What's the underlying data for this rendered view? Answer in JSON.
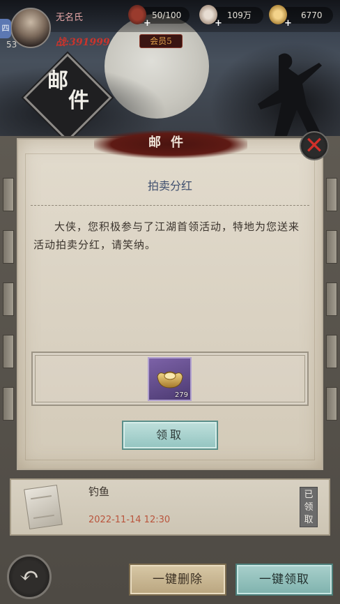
{
  "header": {
    "player_name": "无名氏",
    "level": "53",
    "power": "战:391999",
    "vip": "会员5",
    "left_tab_label": "四",
    "resources": [
      {
        "icon": "stamina-gourd-icon",
        "value": "50/100"
      },
      {
        "icon": "copper-coin-icon",
        "value": "109万"
      },
      {
        "icon": "gold-ingot-icon",
        "value": "6770"
      }
    ],
    "page_title": [
      "邮",
      "件"
    ]
  },
  "dialog": {
    "banner_title": "邮件",
    "close_icon": "close-x-icon",
    "subject": "拍卖分红",
    "body": "大侠，您积极参与了江湖首领活动，特地为您送来活动拍卖分红，请笑纳。",
    "reward": {
      "icon": "gold-ingot-icon",
      "count": "279"
    },
    "claim_label": "领取"
  },
  "mail_list": [
    {
      "icon": "envelope-icon",
      "title": "钓鱼",
      "date": "2022-11-14 12:30",
      "status": "已领取"
    }
  ],
  "footer": {
    "back_icon": "back-arrow-icon",
    "delete_all_label": "一键删除",
    "claim_all_label": "一键领取"
  },
  "colors": {
    "accent_red": "#c9342c",
    "claim_teal": "#93c4c0",
    "paper": "#ddd5c6"
  }
}
